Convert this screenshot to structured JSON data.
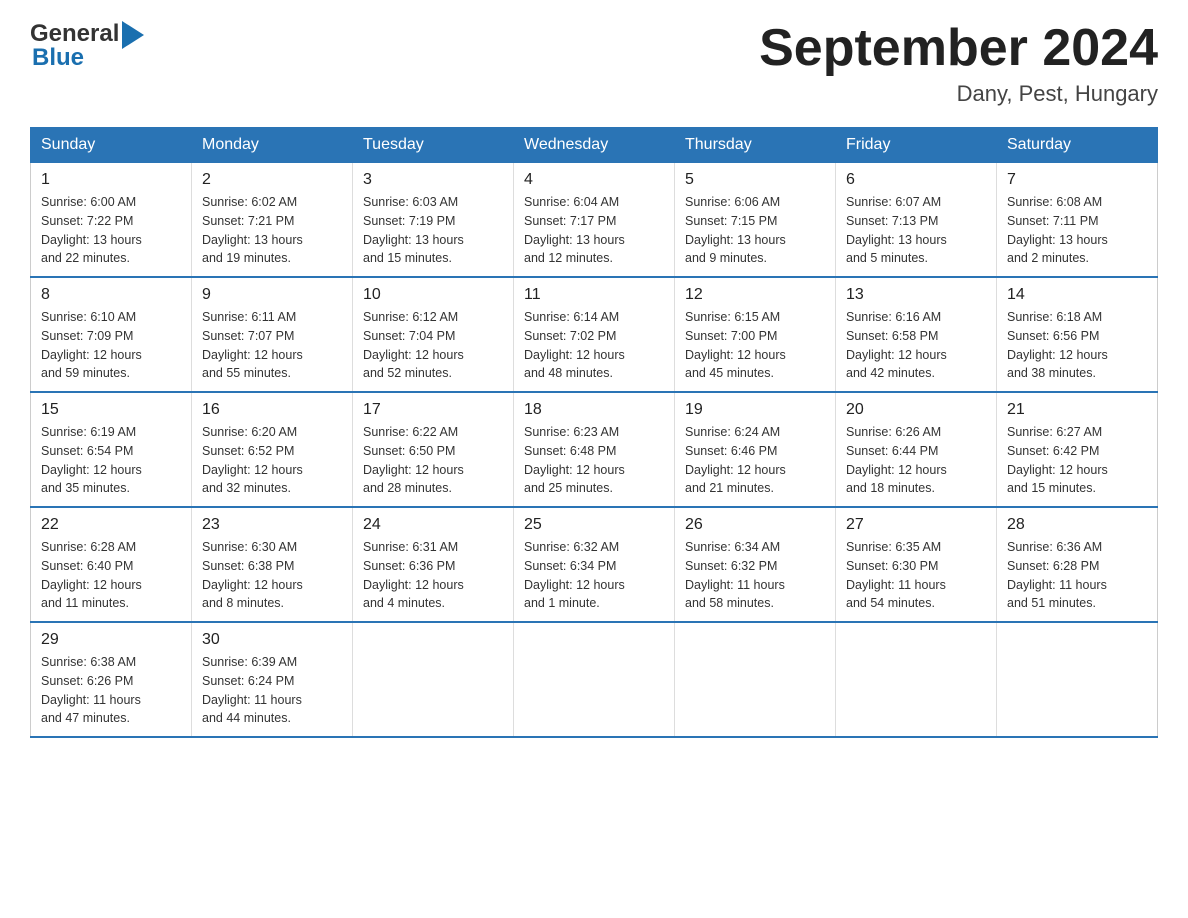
{
  "header": {
    "month_title": "September 2024",
    "location": "Dany, Pest, Hungary",
    "logo_general": "General",
    "logo_blue": "Blue"
  },
  "days_of_week": [
    "Sunday",
    "Monday",
    "Tuesday",
    "Wednesday",
    "Thursday",
    "Friday",
    "Saturday"
  ],
  "weeks": [
    [
      {
        "day": "1",
        "info": "Sunrise: 6:00 AM\nSunset: 7:22 PM\nDaylight: 13 hours\nand 22 minutes."
      },
      {
        "day": "2",
        "info": "Sunrise: 6:02 AM\nSunset: 7:21 PM\nDaylight: 13 hours\nand 19 minutes."
      },
      {
        "day": "3",
        "info": "Sunrise: 6:03 AM\nSunset: 7:19 PM\nDaylight: 13 hours\nand 15 minutes."
      },
      {
        "day": "4",
        "info": "Sunrise: 6:04 AM\nSunset: 7:17 PM\nDaylight: 13 hours\nand 12 minutes."
      },
      {
        "day": "5",
        "info": "Sunrise: 6:06 AM\nSunset: 7:15 PM\nDaylight: 13 hours\nand 9 minutes."
      },
      {
        "day": "6",
        "info": "Sunrise: 6:07 AM\nSunset: 7:13 PM\nDaylight: 13 hours\nand 5 minutes."
      },
      {
        "day": "7",
        "info": "Sunrise: 6:08 AM\nSunset: 7:11 PM\nDaylight: 13 hours\nand 2 minutes."
      }
    ],
    [
      {
        "day": "8",
        "info": "Sunrise: 6:10 AM\nSunset: 7:09 PM\nDaylight: 12 hours\nand 59 minutes."
      },
      {
        "day": "9",
        "info": "Sunrise: 6:11 AM\nSunset: 7:07 PM\nDaylight: 12 hours\nand 55 minutes."
      },
      {
        "day": "10",
        "info": "Sunrise: 6:12 AM\nSunset: 7:04 PM\nDaylight: 12 hours\nand 52 minutes."
      },
      {
        "day": "11",
        "info": "Sunrise: 6:14 AM\nSunset: 7:02 PM\nDaylight: 12 hours\nand 48 minutes."
      },
      {
        "day": "12",
        "info": "Sunrise: 6:15 AM\nSunset: 7:00 PM\nDaylight: 12 hours\nand 45 minutes."
      },
      {
        "day": "13",
        "info": "Sunrise: 6:16 AM\nSunset: 6:58 PM\nDaylight: 12 hours\nand 42 minutes."
      },
      {
        "day": "14",
        "info": "Sunrise: 6:18 AM\nSunset: 6:56 PM\nDaylight: 12 hours\nand 38 minutes."
      }
    ],
    [
      {
        "day": "15",
        "info": "Sunrise: 6:19 AM\nSunset: 6:54 PM\nDaylight: 12 hours\nand 35 minutes."
      },
      {
        "day": "16",
        "info": "Sunrise: 6:20 AM\nSunset: 6:52 PM\nDaylight: 12 hours\nand 32 minutes."
      },
      {
        "day": "17",
        "info": "Sunrise: 6:22 AM\nSunset: 6:50 PM\nDaylight: 12 hours\nand 28 minutes."
      },
      {
        "day": "18",
        "info": "Sunrise: 6:23 AM\nSunset: 6:48 PM\nDaylight: 12 hours\nand 25 minutes."
      },
      {
        "day": "19",
        "info": "Sunrise: 6:24 AM\nSunset: 6:46 PM\nDaylight: 12 hours\nand 21 minutes."
      },
      {
        "day": "20",
        "info": "Sunrise: 6:26 AM\nSunset: 6:44 PM\nDaylight: 12 hours\nand 18 minutes."
      },
      {
        "day": "21",
        "info": "Sunrise: 6:27 AM\nSunset: 6:42 PM\nDaylight: 12 hours\nand 15 minutes."
      }
    ],
    [
      {
        "day": "22",
        "info": "Sunrise: 6:28 AM\nSunset: 6:40 PM\nDaylight: 12 hours\nand 11 minutes."
      },
      {
        "day": "23",
        "info": "Sunrise: 6:30 AM\nSunset: 6:38 PM\nDaylight: 12 hours\nand 8 minutes."
      },
      {
        "day": "24",
        "info": "Sunrise: 6:31 AM\nSunset: 6:36 PM\nDaylight: 12 hours\nand 4 minutes."
      },
      {
        "day": "25",
        "info": "Sunrise: 6:32 AM\nSunset: 6:34 PM\nDaylight: 12 hours\nand 1 minute."
      },
      {
        "day": "26",
        "info": "Sunrise: 6:34 AM\nSunset: 6:32 PM\nDaylight: 11 hours\nand 58 minutes."
      },
      {
        "day": "27",
        "info": "Sunrise: 6:35 AM\nSunset: 6:30 PM\nDaylight: 11 hours\nand 54 minutes."
      },
      {
        "day": "28",
        "info": "Sunrise: 6:36 AM\nSunset: 6:28 PM\nDaylight: 11 hours\nand 51 minutes."
      }
    ],
    [
      {
        "day": "29",
        "info": "Sunrise: 6:38 AM\nSunset: 6:26 PM\nDaylight: 11 hours\nand 47 minutes."
      },
      {
        "day": "30",
        "info": "Sunrise: 6:39 AM\nSunset: 6:24 PM\nDaylight: 11 hours\nand 44 minutes."
      },
      {
        "day": "",
        "info": ""
      },
      {
        "day": "",
        "info": ""
      },
      {
        "day": "",
        "info": ""
      },
      {
        "day": "",
        "info": ""
      },
      {
        "day": "",
        "info": ""
      }
    ]
  ]
}
